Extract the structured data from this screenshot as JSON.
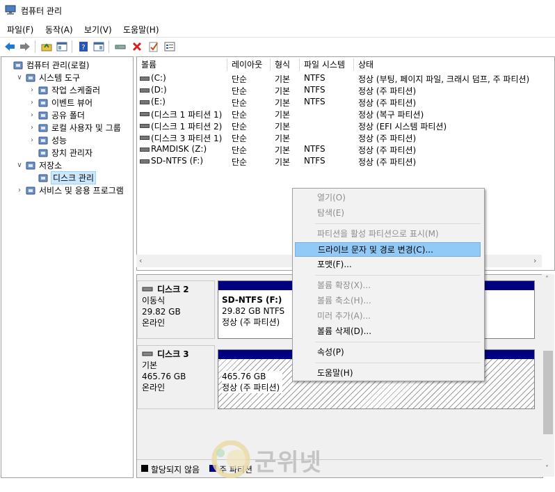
{
  "window": {
    "title": "컴퓨터 관리",
    "icon": "computer-management-icon"
  },
  "menu": [
    "파일(F)",
    "동작(A)",
    "보기(V)",
    "도움말(H)"
  ],
  "toolbar": {
    "buttons": [
      "back-arrow-icon",
      "forward-arrow-icon",
      "up-folder-icon",
      "show-hide-tree-icon",
      "help-icon",
      "properties-pane-icon",
      "connect-icon",
      "delete-icon",
      "check-icon",
      "list-icon"
    ],
    "colors": {
      "back": "#1e78d7",
      "forward": "#1e78d7",
      "delete": "#d42020"
    }
  },
  "tree": [
    {
      "label": "컴퓨터 관리(로컬)",
      "depth": 0,
      "expander": "",
      "icon": "computer-icon"
    },
    {
      "label": "시스템 도구",
      "depth": 1,
      "expander": "v",
      "icon": "tools-icon"
    },
    {
      "label": "작업 스케줄러",
      "depth": 2,
      "expander": ">",
      "icon": "clock-icon"
    },
    {
      "label": "이벤트 뷰어",
      "depth": 2,
      "expander": ">",
      "icon": "event-log-icon"
    },
    {
      "label": "공유 폴더",
      "depth": 2,
      "expander": ">",
      "icon": "shared-folder-icon"
    },
    {
      "label": "로컬 사용자 및 그룹",
      "depth": 2,
      "expander": ">",
      "icon": "users-icon"
    },
    {
      "label": "성능",
      "depth": 2,
      "expander": ">",
      "icon": "performance-icon"
    },
    {
      "label": "장치 관리자",
      "depth": 2,
      "expander": "",
      "icon": "device-manager-icon"
    },
    {
      "label": "저장소",
      "depth": 1,
      "expander": "v",
      "icon": "storage-icon"
    },
    {
      "label": "디스크 관리",
      "depth": 2,
      "expander": "",
      "icon": "disk-management-icon",
      "selected": true
    },
    {
      "label": "서비스 및 응용 프로그램",
      "depth": 1,
      "expander": ">",
      "icon": "services-icon"
    }
  ],
  "volumes": {
    "columns": [
      "볼륨",
      "레이아웃",
      "형식",
      "파일 시스템",
      "상태"
    ],
    "rows": [
      [
        "(C:)",
        "단순",
        "기본",
        "NTFS",
        "정상 (부팅, 페이지 파일, 크래시 덤프, 주 파티션)"
      ],
      [
        "(D:)",
        "단순",
        "기본",
        "NTFS",
        "정상 (주 파티션)"
      ],
      [
        "(E:)",
        "단순",
        "기본",
        "NTFS",
        "정상 (주 파티션)"
      ],
      [
        "(디스크 1 파티션 1)",
        "단순",
        "기본",
        "",
        "정상 (복구 파티션)"
      ],
      [
        "(디스크 1 파티션 2)",
        "단순",
        "기본",
        "",
        "정상 (EFI 시스템 파티션)"
      ],
      [
        "(디스크 3 파티션 1)",
        "단순",
        "기본",
        "",
        "정상 (주 파티션)"
      ],
      [
        "RAMDISK (Z:)",
        "단순",
        "기본",
        "NTFS",
        "정상 (주 파티션)"
      ],
      [
        "SD-NTFS (F:)",
        "단순",
        "기본",
        "NTFS",
        "정상 (주 파티션)"
      ]
    ]
  },
  "disks": [
    {
      "name": "디스크 2",
      "lines": [
        "이동식",
        "29.82 GB",
        "온라인"
      ],
      "partition": {
        "name": "SD-NTFS  (F:)",
        "size": "29.82 GB NTFS",
        "status": "정상 (주 파티션)"
      }
    },
    {
      "name": "디스크 3",
      "lines": [
        "기본",
        "465.76 GB",
        "온라인"
      ],
      "partition": {
        "name": "",
        "size": "465.76 GB",
        "status": "정상 (주 파티션)"
      }
    }
  ],
  "legend": [
    {
      "label": "할당되지 않음",
      "color": "#000000"
    },
    {
      "label": "주 파티션",
      "color": "#000080"
    }
  ],
  "context_menu": [
    {
      "label": "열기(O)",
      "enabled": false
    },
    {
      "label": "탐색(E)",
      "enabled": false
    },
    {
      "sep": true
    },
    {
      "label": "파티션을 활성 파티션으로 표시(M)",
      "enabled": false
    },
    {
      "label": "드라이브 문자 및 경로 변경(C)...",
      "enabled": true,
      "highlighted": true
    },
    {
      "label": "포맷(F)...",
      "enabled": true
    },
    {
      "sep": true
    },
    {
      "label": "볼륨 확장(X)...",
      "enabled": false
    },
    {
      "label": "볼륨 축소(H)...",
      "enabled": false
    },
    {
      "label": "미러 추가(A)...",
      "enabled": false
    },
    {
      "label": "볼륨 삭제(D)...",
      "enabled": true
    },
    {
      "sep": true
    },
    {
      "label": "속성(P)",
      "enabled": true
    },
    {
      "sep": true
    },
    {
      "label": "도움말(H)",
      "enabled": true
    }
  ],
  "watermark": {
    "text": "군위넷",
    "logo": "gunwinet-logo-icon"
  },
  "colors": {
    "selection": "#cce8ff",
    "menu_highlight": "#91c9f7",
    "partition_bar": "#000080"
  }
}
